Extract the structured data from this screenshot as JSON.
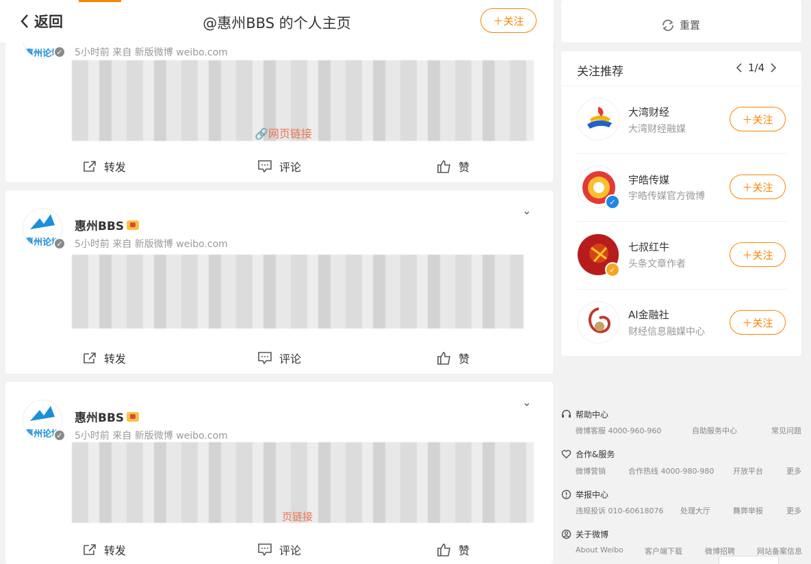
{
  "header": {
    "back_label": "返回",
    "title": "@惠州BBS 的个人主页",
    "follow_label": "＋关注"
  },
  "posts": [
    {
      "time_source": "5小时前 来自 新版微博 weibo.com",
      "link_label": "网页链接",
      "repost": "转发",
      "comment": "评论",
      "like": "赞"
    },
    {
      "name": "惠州BBS",
      "avatar_text": "惠州论坛",
      "time_source": "5小时前 来自 新版微博 weibo.com",
      "repost": "转发",
      "comment": "评论",
      "like": "赞"
    },
    {
      "name": "惠州BBS",
      "avatar_text": "惠州论坛",
      "time_source": "5小时前 来自 新版微博 weibo.com",
      "link_label": "页链接",
      "repost": "转发",
      "comment": "评论",
      "like": "赞"
    }
  ],
  "sidebar": {
    "reset_label": "重置",
    "recommend_title": "关注推荐",
    "pager": "1/4",
    "recommendations": [
      {
        "name": "大湾财经",
        "desc": "大湾财经融媒",
        "follow": "＋关注"
      },
      {
        "name": "宇皓传媒",
        "desc": "宇皓传媒官方微博",
        "follow": "＋关注"
      },
      {
        "name": "七叔红牛",
        "desc": "头条文章作者",
        "follow": "＋关注"
      },
      {
        "name": "AI金融社",
        "desc": "财经信息融媒中心",
        "follow": "＋关注"
      }
    ]
  },
  "footer": {
    "help": {
      "title": "帮助中心",
      "items": [
        "微博客服 4000-960-960",
        "自助服务中心",
        "常见问题"
      ]
    },
    "coop": {
      "title": "合作&服务",
      "items": [
        "微博营销",
        "合作热线 4000-980-980",
        "开放平台",
        "更多"
      ]
    },
    "report": {
      "title": "举报中心",
      "items": [
        "违规投诉 010-60618076",
        "处理大厅",
        "舞弊举报",
        "更多"
      ]
    },
    "about": {
      "title": "关于微博",
      "items": [
        "About Weibo",
        "客户端下载",
        "微博招聘",
        "网站备案信息"
      ]
    }
  },
  "colors": {
    "accent": "#ff8200",
    "link": "#eb7350",
    "background": "#f2f2f2"
  }
}
